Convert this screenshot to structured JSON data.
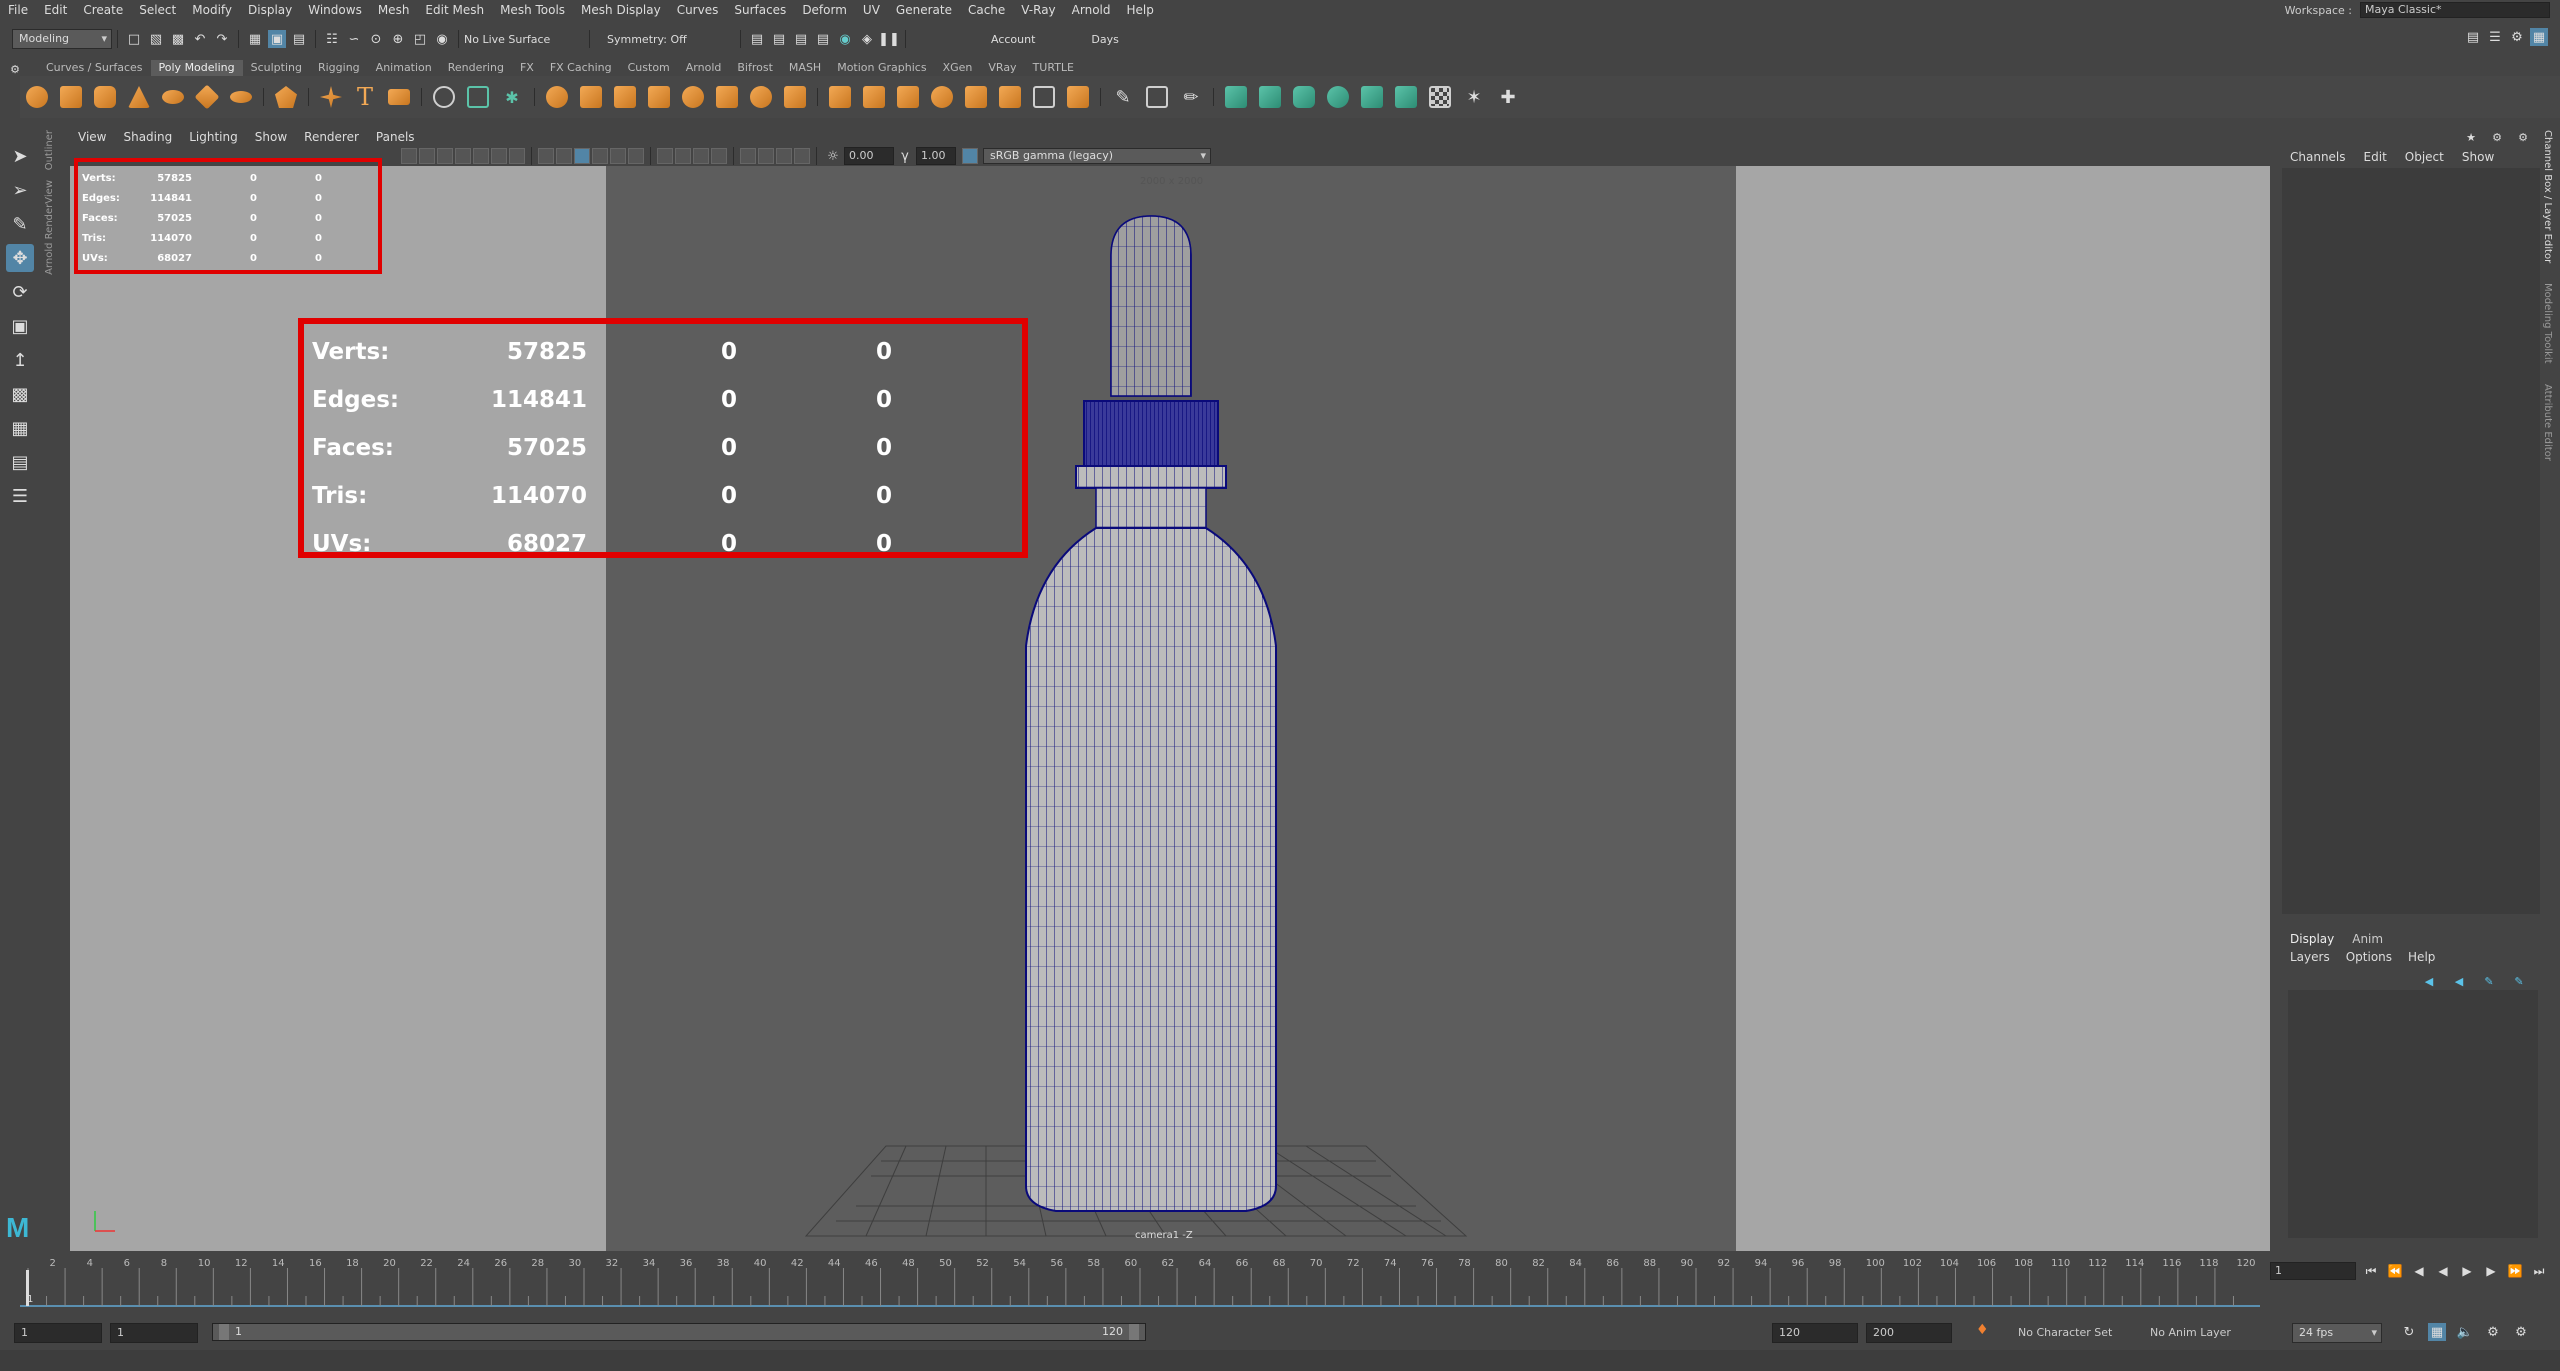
{
  "menubar": {
    "items": [
      "File",
      "Edit",
      "Create",
      "Select",
      "Modify",
      "Display",
      "Windows",
      "Mesh",
      "Edit Mesh",
      "Mesh Tools",
      "Mesh Display",
      "Curves",
      "Surfaces",
      "Deform",
      "UV",
      "Generate",
      "Cache",
      "V-Ray",
      "Arnold",
      "Help"
    ],
    "workspace_label": "Workspace :",
    "workspace_value": "Maya Classic*"
  },
  "statusline": {
    "mode": "Modeling",
    "live_surface": "No Live Surface",
    "symmetry": "Symmetry: Off",
    "account": "Account",
    "days": "Days"
  },
  "shelf": {
    "tabs": [
      "Curves / Surfaces",
      "Poly Modeling",
      "Sculpting",
      "Rigging",
      "Animation",
      "Rendering",
      "FX",
      "FX Caching",
      "Custom",
      "Arnold",
      "Bifrost",
      "MASH",
      "Motion Graphics",
      "XGen",
      "VRay",
      "TURTLE"
    ],
    "active_tab": "Poly Modeling"
  },
  "left_sidetabs": [
    "Outliner",
    "Arnold RenderView"
  ],
  "right_sidetabs": [
    "Channel Box / Layer Editor",
    "Modeling Toolkit",
    "Attribute Editor"
  ],
  "panel": {
    "menu": [
      "View",
      "Shading",
      "Lighting",
      "Show",
      "Renderer",
      "Panels"
    ],
    "exposure": "0.00",
    "gamma": "1.00",
    "color_space": "sRGB gamma (legacy)",
    "resolution": "2000 x 2000",
    "camera": "camera1 -Z"
  },
  "hud": {
    "rows": [
      {
        "label": "Verts:",
        "v1": "57825",
        "v2": "0",
        "v3": "0"
      },
      {
        "label": "Edges:",
        "v1": "114841",
        "v2": "0",
        "v3": "0"
      },
      {
        "label": "Faces:",
        "v1": "57025",
        "v2": "0",
        "v3": "0"
      },
      {
        "label": "Tris:",
        "v1": "114070",
        "v2": "0",
        "v3": "0"
      },
      {
        "label": "UVs:",
        "v1": "68027",
        "v2": "0",
        "v3": "0"
      }
    ]
  },
  "channelbox": {
    "menu": [
      "Channels",
      "Edit",
      "Object",
      "Show"
    ],
    "layer_tabs": [
      "Display",
      "Anim"
    ],
    "layer_menu": [
      "Layers",
      "Options",
      "Help"
    ]
  },
  "timeline": {
    "ticks": [
      "2",
      "4",
      "6",
      "8",
      "10",
      "12",
      "14",
      "16",
      "18",
      "20",
      "22",
      "24",
      "26",
      "28",
      "30",
      "32",
      "34",
      "36",
      "38",
      "40",
      "42",
      "44",
      "46",
      "48",
      "50",
      "52",
      "54",
      "56",
      "58",
      "60",
      "62",
      "64",
      "66",
      "68",
      "70",
      "72",
      "74",
      "76",
      "78",
      "80",
      "82",
      "84",
      "86",
      "88",
      "90",
      "92",
      "94",
      "96",
      "98",
      "100",
      "102",
      "104",
      "106",
      "108",
      "110",
      "112",
      "114",
      "116",
      "118",
      "120"
    ],
    "current_marker": "1",
    "current_frame": "1"
  },
  "range": {
    "start": "1",
    "anim_start": "1",
    "range_start": "1",
    "range_end": "120",
    "end": "120",
    "anim_end": "200",
    "character_set": "No Character Set",
    "anim_layer": "No Anim Layer",
    "fps": "24 fps"
  },
  "colors": {
    "accent_red": "#e00000",
    "wire": "#0a0a7a",
    "selected_tool": "#5285a6"
  }
}
